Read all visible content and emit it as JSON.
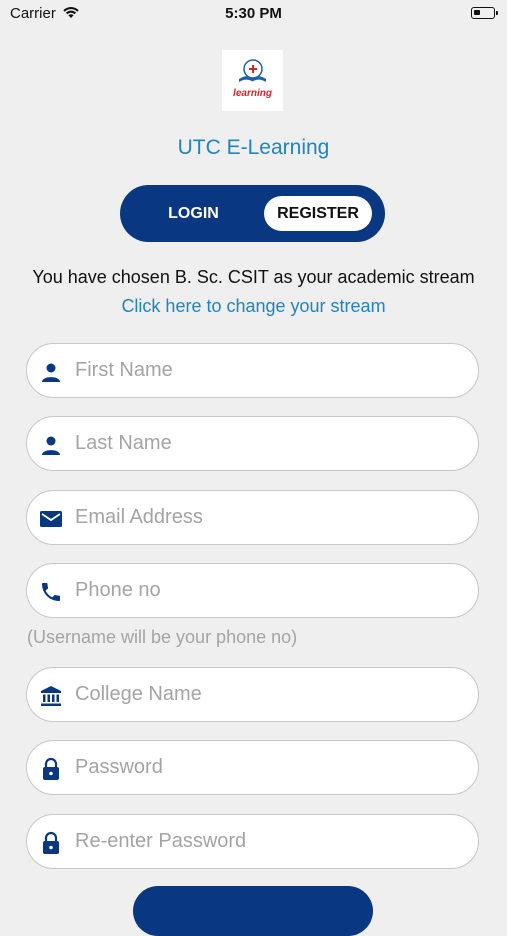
{
  "status_bar": {
    "carrier": "Carrier",
    "time": "5:30 PM"
  },
  "logo": {
    "text": "learning"
  },
  "app_title": "UTC E-Learning",
  "tabs": {
    "login": "LOGIN",
    "register": "REGISTER",
    "active": "register"
  },
  "stream": {
    "info": "You have chosen B. Sc. CSIT as your academic stream",
    "change_link": "Click here to change your stream"
  },
  "form": {
    "first_name": {
      "placeholder": "First Name",
      "value": "",
      "icon": "person-icon"
    },
    "last_name": {
      "placeholder": "Last Name",
      "value": "",
      "icon": "person-icon"
    },
    "email": {
      "placeholder": "Email Address",
      "value": "",
      "icon": "mail-icon"
    },
    "phone": {
      "placeholder": "Phone no",
      "value": "",
      "icon": "phone-icon"
    },
    "phone_hint": "(Username will be your phone no)",
    "college": {
      "placeholder": "College Name",
      "value": "",
      "icon": "bank-icon"
    },
    "password": {
      "placeholder": "Password",
      "value": "",
      "icon": "lock-icon"
    },
    "password_confirm": {
      "placeholder": "Re-enter Password",
      "value": "",
      "icon": "lock-icon"
    }
  },
  "colors": {
    "primary": "#0a3781",
    "link": "#1f84c4",
    "background": "#efefef",
    "placeholder": "#a4a4a4"
  }
}
